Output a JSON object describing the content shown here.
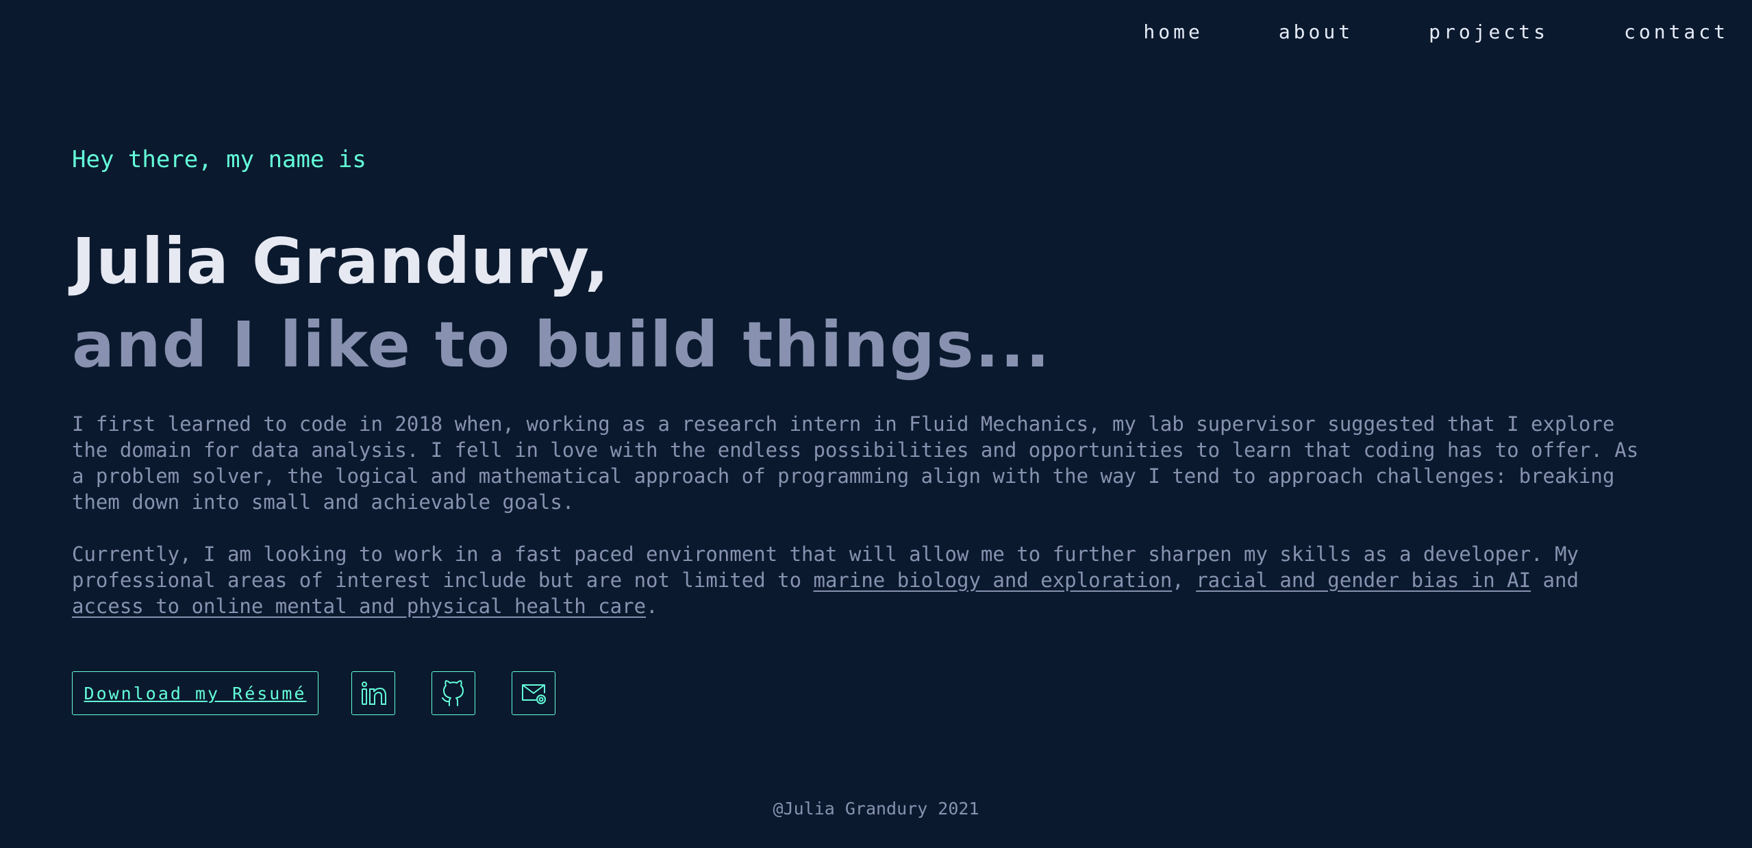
{
  "nav": {
    "items": [
      {
        "label": "home"
      },
      {
        "label": "about"
      },
      {
        "label": "projects"
      },
      {
        "label": "contact"
      }
    ]
  },
  "hero": {
    "greeting": "Hey there, my name is",
    "name": "Julia Grandury,",
    "tagline": "and I like to build things...",
    "paragraph1": "I first learned to code in 2018 when, working as a research intern in Fluid Mechanics, my lab supervisor suggested that I explore the domain for data analysis. I fell in love with the endless possibilities and opportunities to learn that coding has to offer. As a problem solver, the logical and mathematical approach of programming align with the way I tend to approach challenges: breaking them down into small and achievable goals.",
    "paragraph2": {
      "intro": "Currently, I am looking to work in a fast paced environment that will allow me to further sharpen my skills as a developer. My professional areas of interest include but are not limited to ",
      "link1": "marine biology and exploration",
      "sep1": ", ",
      "link2": "racial and gender bias in AI",
      "sep2": " and ",
      "link3": "access to online mental and physical health care",
      "end": "."
    }
  },
  "actions": {
    "resume_label": "Download my Résumé",
    "icons": [
      "linkedin-icon",
      "github-icon",
      "email-icon"
    ]
  },
  "footer": {
    "text": "@Julia Grandury 2021"
  },
  "colors": {
    "background": "#0b192e",
    "accent": "#64ffda",
    "heading": "#e6e9f2",
    "muted": "#8892b0"
  }
}
